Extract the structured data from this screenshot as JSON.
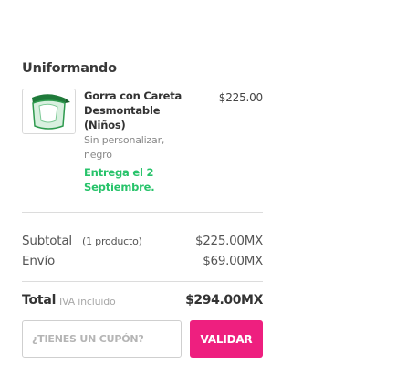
{
  "store": {
    "name": "Uniformando"
  },
  "product": {
    "icon": "face-shield-cap-icon",
    "name": "Gorra con Careta Desmontable (Niños)",
    "price": "$225.00",
    "variant": "Sin personalizar, negro",
    "delivery": "Entrega el 2 Septiembre."
  },
  "summary": {
    "subtotal_label": "Subtotal",
    "subtotal_count": "(1 producto)",
    "subtotal_value": "$225.00MX",
    "shipping_label": "Envío",
    "shipping_value": "$69.00MX",
    "total_label": "Total",
    "total_note": "IVA incluido",
    "total_value": "$294.00MX"
  },
  "coupon": {
    "placeholder": "¿TIENES UN CUPÓN?",
    "value": "",
    "button_label": "VALIDAR"
  },
  "colors": {
    "accent": "#ee1f7f",
    "delivery_green": "#27c36a"
  }
}
